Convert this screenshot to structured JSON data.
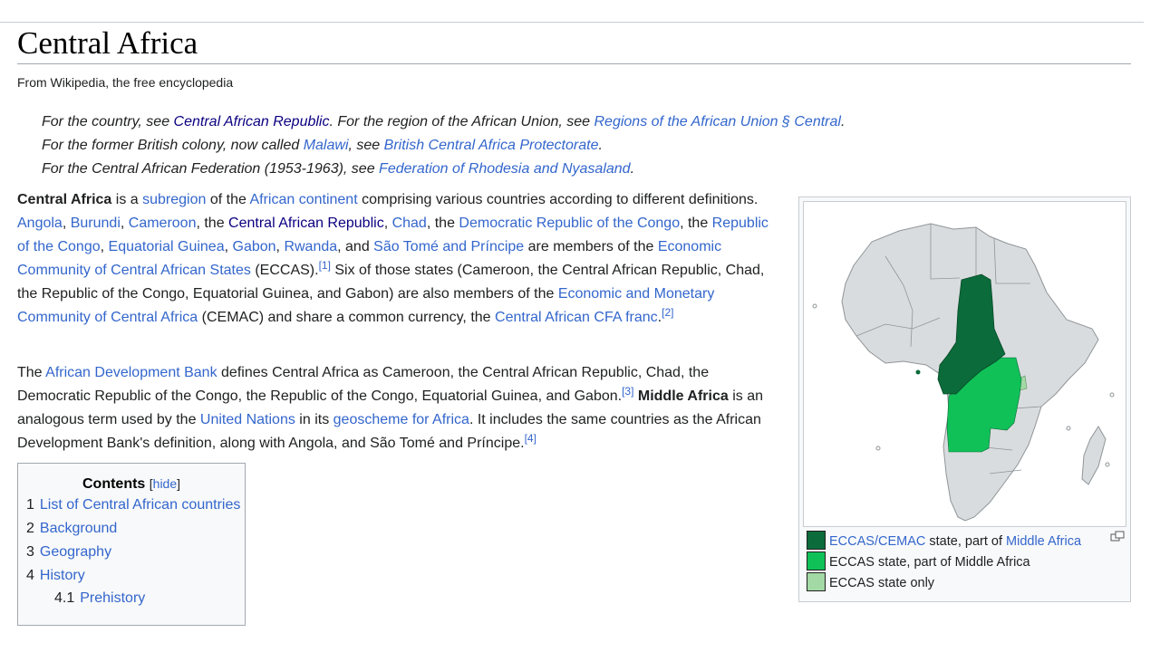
{
  "article": {
    "title": "Central Africa",
    "tagline": "From Wikipedia, the free encyclopedia"
  },
  "hatnotes": [
    {
      "t1": "For the country, see ",
      "l1": "Central African Republic",
      "t2": ". For the region of the African Union, see ",
      "l2": "Regions of the African Union § Central",
      "t3": "."
    },
    {
      "t1": "For the former British colony, now called ",
      "l1": "Malawi",
      "t2": ", see ",
      "l2": "British Central Africa Protectorate",
      "t3": "."
    },
    {
      "t1": "For the Central African Federation (1953-1963), see ",
      "l1": "Federation of Rhodesia and Nyasaland",
      "t2": "."
    }
  ],
  "para1": {
    "bold": "Central Africa",
    "s1": " is a ",
    "subregion": "subregion",
    "s2": " of the ",
    "african_continent": "African continent",
    "s3": " comprising various countries according to different definitions. ",
    "angola": "Angola",
    "c1": ", ",
    "burundi": "Burundi",
    "c2": ", ",
    "cameroon": "Cameroon",
    "s4": ", the ",
    "car": "Central African Republic",
    "c3": ", ",
    "chad": "Chad",
    "s5": ", the ",
    "drc": "Democratic Republic of the Congo",
    "s6": ", the ",
    "roc": "Republic of the Congo",
    "c4": ", ",
    "eq_guinea": "Equatorial Guinea",
    "c5": ", ",
    "gabon": "Gabon",
    "c6": ", ",
    "rwanda": "Rwanda",
    "s7": ", and ",
    "sao_tome": "São Tomé and Príncipe",
    "s8": " are members of the ",
    "eccas": "Economic Community of Central African States",
    "s9": " (ECCAS).",
    "ref1": "[1]",
    "s10": " Six of those states (Cameroon, the Central African Republic, Chad, the Republic of the Congo, Equatorial Guinea, and Gabon) are also members of the ",
    "cemac": "Economic and Monetary Community of Central Africa",
    "s11": " (CEMAC) and share a common currency, the ",
    "cfa": "Central African CFA franc",
    "s12": ".",
    "ref2": "[2]"
  },
  "para2": {
    "s1": "The ",
    "afdb": "African Development Bank",
    "s2": " defines Central Africa as Cameroon, the Central African Republic, Chad, the Democratic Republic of the Congo, the Republic of the Congo, Equatorial Guinea, and Gabon.",
    "ref3": "[3]",
    "s3": " ",
    "bold": "Middle Africa",
    "s4": " is an analogous term used by the ",
    "un": "United Nations",
    "s5": " in its ",
    "geoscheme": "geoscheme for Africa",
    "s6": ". It includes the same countries as the African Development Bank's definition, along with Angola, and São Tomé and Príncipe.",
    "ref4": "[4]"
  },
  "toc": {
    "title": "Contents",
    "open": "[",
    "hide": "hide",
    "close": "]",
    "items": [
      {
        "num": "1",
        "label": "List of Central African countries"
      },
      {
        "num": "2",
        "label": "Background"
      },
      {
        "num": "3",
        "label": "Geography"
      },
      {
        "num": "4",
        "label": "History"
      },
      {
        "num": "4.1",
        "label": "Prehistory"
      }
    ]
  },
  "infobox": {
    "magnify_icon": "magnify-icon",
    "legend": [
      {
        "link": "ECCAS/CEMAC",
        "text": " state, part of ",
        "link2": "Middle Africa",
        "color": "#0b6b3a"
      },
      {
        "text": "ECCAS state, part of Middle Africa",
        "color": "#10c157"
      },
      {
        "text": "ECCAS state only",
        "color": "#a3d9a4"
      }
    ]
  },
  "colors": {
    "link": "#3366cc",
    "visited_link": "#0b0080",
    "land": "#d9dcde",
    "border": "#9aa0a3"
  }
}
